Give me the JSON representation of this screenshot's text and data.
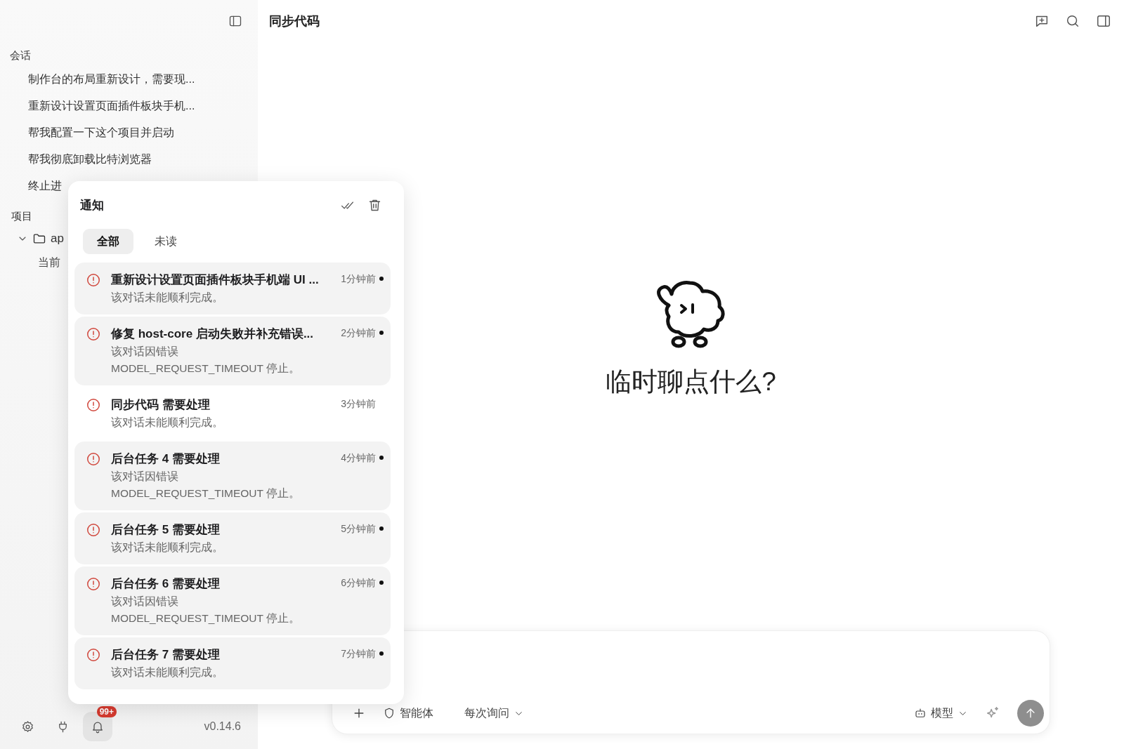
{
  "sidebar": {
    "sections": [
      {
        "title": "会话",
        "items": [
          {
            "label": "制作台的布局重新设计，需要现..."
          },
          {
            "label": "重新设计设置页面插件板块手机..."
          },
          {
            "label": "帮我配置一下这个项目并启动"
          },
          {
            "label": "帮我彻底卸载比特浏览器"
          },
          {
            "label": "终止进"
          }
        ]
      },
      {
        "title": "项目",
        "tree": [
          {
            "label": "ap",
            "expanded": true,
            "children": [
              {
                "label": "当前"
              }
            ]
          }
        ]
      }
    ],
    "footer": {
      "notifications_open": true,
      "badge": "99+",
      "version": "v0.14.6"
    }
  },
  "header": {
    "title": "同步代码"
  },
  "empty_state": {
    "prompt": "临时聊点什么?"
  },
  "composer": {
    "agent": "智能体",
    "approval": "每次询问",
    "model": "模型"
  },
  "notifications": {
    "title": "通知",
    "tabs": [
      {
        "label": "全部",
        "selected": true
      },
      {
        "label": "未读",
        "selected": false
      }
    ],
    "items": [
      {
        "title": "重新设计设置页面插件板块手机端 UI ...",
        "time": "1分钟前",
        "body": "该对话未能顺利完成。",
        "unread": true
      },
      {
        "title": "修复 host-core 启动失败并补充错误...",
        "time": "2分钟前",
        "body": "该对话因错误 MODEL_REQUEST_TIMEOUT 停止。",
        "unread": true
      },
      {
        "title": "同步代码 需要处理",
        "time": "3分钟前",
        "body": "该对话未能顺利完成。",
        "unread": false
      },
      {
        "title": "后台任务 4 需要处理",
        "time": "4分钟前",
        "body": "该对话因错误 MODEL_REQUEST_TIMEOUT 停止。",
        "unread": true
      },
      {
        "title": "后台任务 5 需要处理",
        "time": "5分钟前",
        "body": "该对话未能顺利完成。",
        "unread": true
      },
      {
        "title": "后台任务 6 需要处理",
        "time": "6分钟前",
        "body": "该对话因错误 MODEL_REQUEST_TIMEOUT 停止。",
        "unread": true
      },
      {
        "title": "后台任务 7 需要处理",
        "time": "7分钟前",
        "body": "该对话未能顺利完成。",
        "unread": true
      }
    ]
  }
}
